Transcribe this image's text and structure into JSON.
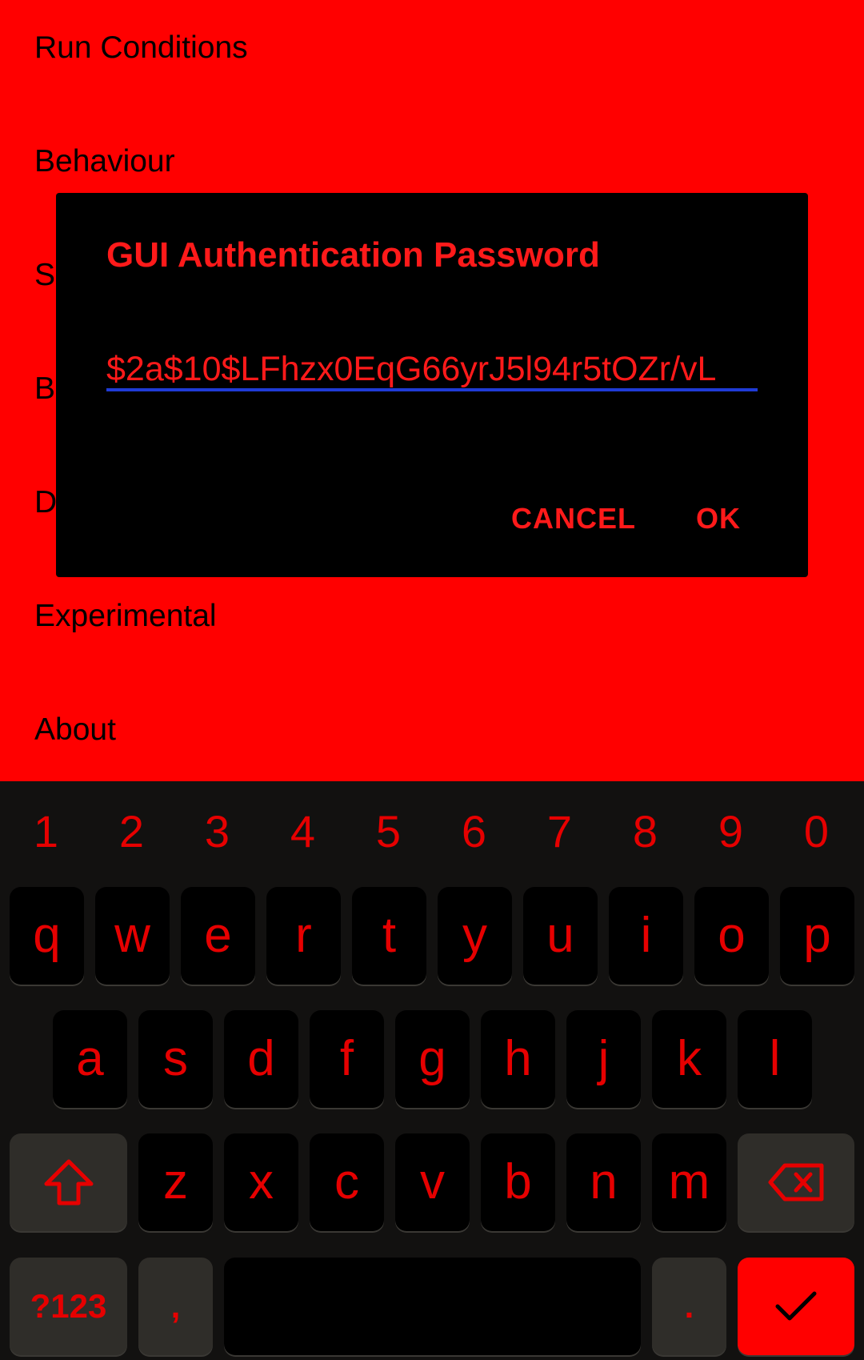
{
  "settings": {
    "items": [
      {
        "label": "Run Conditions"
      },
      {
        "label": "Behaviour"
      },
      {
        "label": "S"
      },
      {
        "label": "B"
      },
      {
        "label": "D"
      },
      {
        "label": "Experimental"
      },
      {
        "label": "About"
      }
    ]
  },
  "dialog": {
    "title": "GUI Authentication Password",
    "field_value": "$2a$10$LFhzx0EqG66yrJ5l94r5tOZr/vL",
    "cancel_label": "CANCEL",
    "ok_label": "OK"
  },
  "keyboard": {
    "number_row": [
      "1",
      "2",
      "3",
      "4",
      "5",
      "6",
      "7",
      "8",
      "9",
      "0"
    ],
    "row1": [
      "q",
      "w",
      "e",
      "r",
      "t",
      "y",
      "u",
      "i",
      "o",
      "p"
    ],
    "row2": [
      "a",
      "s",
      "d",
      "f",
      "g",
      "h",
      "j",
      "k",
      "l"
    ],
    "row3": [
      "z",
      "x",
      "c",
      "v",
      "b",
      "n",
      "m"
    ],
    "symbols_label": "?123",
    "comma_label": ",",
    "period_label": ".",
    "shift_icon": "shift-arrow-icon",
    "backspace_icon": "backspace-icon",
    "enter_icon": "checkmark-icon"
  },
  "colors": {
    "background": "#ff0000",
    "dialog_bg": "#000000",
    "accent_text": "#ff1a1a",
    "field_underline": "#1f3bd6",
    "keyboard_bg": "#121110"
  }
}
